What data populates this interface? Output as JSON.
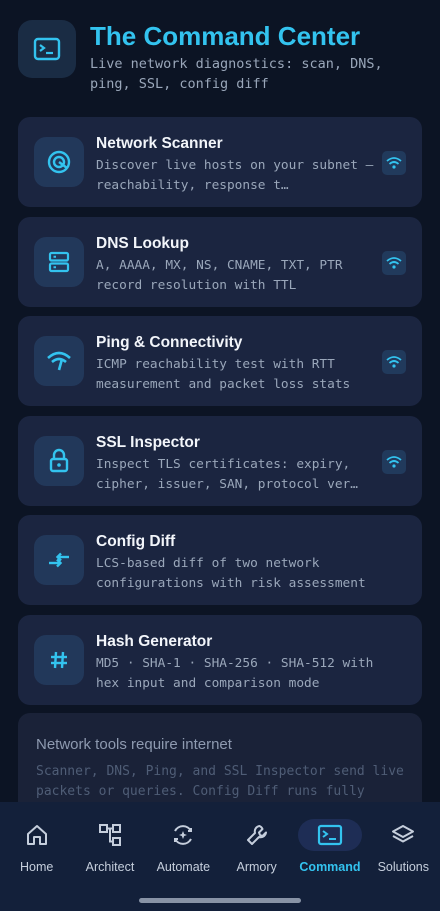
{
  "header": {
    "title": "The Command Center",
    "subtitle": "Live network diagnostics: scan, DNS, ping, SSL, config diff",
    "icon": "terminal-icon"
  },
  "tools": [
    {
      "title": "Network Scanner",
      "desc": "Discover live hosts on your subnet — reachability, response t…",
      "icon": "radar-icon",
      "network": true
    },
    {
      "title": "DNS Lookup",
      "desc": "A, AAAA, MX, NS, CNAME, TXT, PTR record resolution with TTL",
      "icon": "dns-icon",
      "network": true
    },
    {
      "title": "Ping & Connectivity",
      "desc": "ICMP reachability test with RTT measurement and packet loss stats",
      "icon": "signal-icon",
      "network": true
    },
    {
      "title": "SSL Inspector",
      "desc": "Inspect TLS certificates: expiry, cipher, issuer, SAN, protocol ver…",
      "icon": "lock-icon",
      "network": true
    },
    {
      "title": "Config Diff",
      "desc": "LCS-based diff of two network configurations with risk assessment",
      "icon": "compare-arrows-icon",
      "network": false
    },
    {
      "title": "Hash Generator",
      "desc": "MD5 · SHA-1 · SHA-256 · SHA-512 with hex input and comparison mode",
      "icon": "hash-icon",
      "network": false
    }
  ],
  "notice": {
    "title": "Network tools require internet",
    "text": "Scanner, DNS, Ping, and SSL Inspector send live packets or queries. Config Diff runs fully offline."
  },
  "nav": [
    {
      "label": "Home",
      "icon": "home-icon",
      "active": false
    },
    {
      "label": "Architect",
      "icon": "architect-icon",
      "active": false
    },
    {
      "label": "Automate",
      "icon": "automate-icon",
      "active": false
    },
    {
      "label": "Armory",
      "icon": "wrench-icon",
      "active": false
    },
    {
      "label": "Command",
      "icon": "terminal-icon",
      "active": true
    },
    {
      "label": "Solutions",
      "icon": "layers-icon",
      "active": false
    }
  ],
  "colors": {
    "accent": "#33c3ef",
    "background": "#0c1424",
    "card": "#1b2540"
  }
}
